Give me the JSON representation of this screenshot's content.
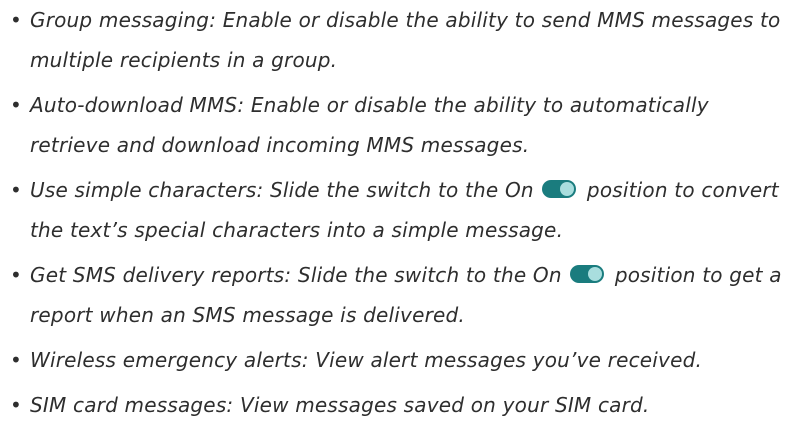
{
  "bullet_char": "•",
  "toggle_color": "#1a7c7e",
  "items": [
    {
      "label": "Group messaging:",
      "text": "Enable or disable the ability to send MMS messages to multiple recipients in a group."
    },
    {
      "label": "Auto-download MMS:",
      "text": "Enable or disable the ability to automatically retrieve and download incoming MMS messages."
    },
    {
      "label": "Use simple characters:",
      "text_before": "Slide the switch to the On",
      "text_after": "position to convert the text’s special characters into a simple message.",
      "toggle_icon": "toggle-on-icon"
    },
    {
      "label": "Get SMS delivery reports:",
      "text_before": "Slide the switch to the On",
      "text_after": "position to get a report when an SMS message is delivered.",
      "toggle_icon": "toggle-on-icon"
    },
    {
      "label": "Wireless emergency alerts:",
      "text": "View alert messages you’ve received."
    },
    {
      "label": "SIM card messages:",
      "text": "View messages saved on your SIM card."
    }
  ]
}
